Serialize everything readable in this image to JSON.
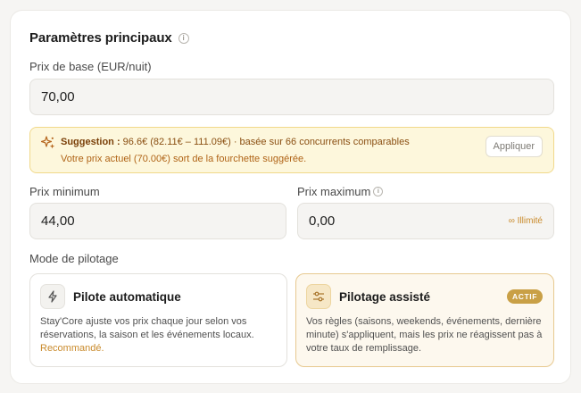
{
  "section": {
    "title": "Paramètres principaux",
    "info_icon": "info-icon"
  },
  "base_price": {
    "label": "Prix de base (EUR/nuit)",
    "value": "70,00"
  },
  "suggestion": {
    "icon": "sparkles-icon",
    "prefix": "Suggestion :",
    "detail": "96.6€ (82.11€ – 111.09€) · basée sur 66 concurrents comparables",
    "warning": "Votre prix actuel (70.00€) sort de la fourchette suggérée.",
    "apply_label": "Appliquer"
  },
  "min_price": {
    "label": "Prix minimum",
    "value": "44,00"
  },
  "max_price": {
    "label": "Prix maximum",
    "value": "0,00",
    "hint": "∞ Illimité"
  },
  "mode": {
    "label": "Mode de pilotage",
    "auto": {
      "icon": "lightning-icon",
      "title": "Pilote automatique",
      "description": "Stay'Core ajuste vos prix chaque jour selon vos réservations, la saison et les événements locaux.",
      "recommended": "Recommandé."
    },
    "assisted": {
      "icon": "sliders-icon",
      "title": "Pilotage assisté",
      "badge": "ACTIF",
      "description": "Vos règles (saisons, weekends, événements, dernière minute) s'appliquent, mais les prix ne réagissent pas à votre taux de remplissage."
    }
  },
  "colors": {
    "accent": "#c9a046",
    "warning_text": "#b06417",
    "suggestion_bg": "#fdf7dc"
  }
}
